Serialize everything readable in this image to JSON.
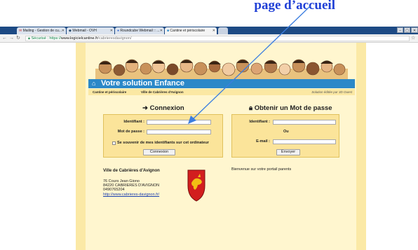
{
  "caption": {
    "text": "page d’accueil"
  },
  "browser": {
    "tabs": [
      {
        "label": "Mailing - Gestion de cu...",
        "icon": "mail-icon"
      },
      {
        "label": "Webmail - OVH",
        "icon": "webmail-icon"
      },
      {
        "label": "Roundcube Webmail :: ...",
        "icon": "roundcube-icon"
      },
      {
        "label": "Cantine et périscolaire",
        "icon": "page-icon"
      }
    ],
    "secure_label": "Sécurisé",
    "url_scheme": "https://",
    "url_host": "www.logicielcantine.fr",
    "url_path": "/cabrieresdavignon/"
  },
  "banner": {
    "title": "Votre solution Enfance"
  },
  "subnav": {
    "left": "Cantine et périscolaire",
    "commune": "Ville de Cabrières d'Avignon",
    "edited": "Solution éditée par 3D Ouest"
  },
  "login": {
    "title": "Connexion",
    "identifiant_label": "Identifiant :",
    "password_label": "Mot de passe :",
    "remember_label": "Se souvenir de mes identifiants sur cet ordinateur",
    "submit": "Connexion"
  },
  "reset": {
    "title": "Obtenir un Mot de passe",
    "identifiant_label": "Identifiant :",
    "or_label": "Ou",
    "email_label": "E-mail :",
    "submit": "Envoyer"
  },
  "contact": {
    "name": "Ville de Cabrières d'Avignon",
    "address1": "76 Cours Jean Giono",
    "address2": "84220 CABRIERES D'AVIGNON",
    "phone": "0490765204",
    "website": "http://www.cabrieres-davignon.fr/"
  },
  "welcome": "Bienvenue sur votre portail parents",
  "colors": {
    "accent": "#2b88c8",
    "panel": "#fbe49a",
    "page": "#fff6cf",
    "arrow": "#3a7de0",
    "caption": "#1f3fd6"
  }
}
